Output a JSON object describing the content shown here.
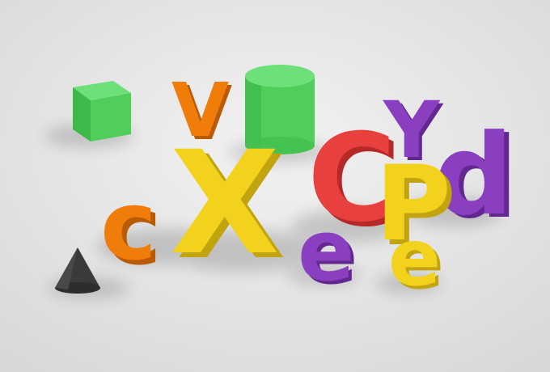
{
  "scene": {
    "background": "#e4e4e4",
    "letters": [
      {
        "id": "letter-v",
        "text": "V",
        "color": "#f07d0a"
      },
      {
        "id": "letter-x",
        "text": "X",
        "color": "#f2d21c"
      },
      {
        "id": "letter-c-orange",
        "text": "c",
        "color": "#f07d0a"
      },
      {
        "id": "letter-c-red",
        "text": "C",
        "color": "#e8403e"
      },
      {
        "id": "letter-y",
        "text": "Y",
        "color": "#8a3fc0"
      },
      {
        "id": "letter-d",
        "text": "d",
        "color": "#8a3fc0"
      },
      {
        "id": "letter-p",
        "text": "P",
        "color": "#f2d21c"
      },
      {
        "id": "letter-e-purple",
        "text": "e",
        "color": "#8a3fc0"
      },
      {
        "id": "letter-e-yellow",
        "text": "e",
        "color": "#f2d21c"
      }
    ],
    "shapes": [
      {
        "id": "green-cube",
        "kind": "cube",
        "color": "#4fcf5a"
      },
      {
        "id": "green-cylinder",
        "kind": "cylinder",
        "color": "#4fcf5a"
      },
      {
        "id": "black-cone",
        "kind": "cone",
        "color": "#3a3a3a"
      }
    ]
  }
}
